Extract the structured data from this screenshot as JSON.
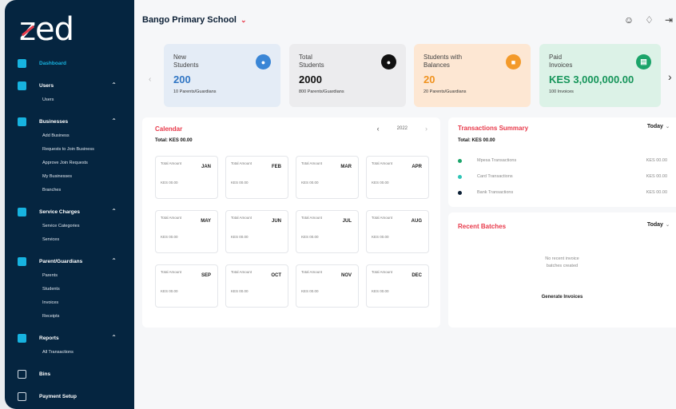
{
  "app": {
    "logo": "zed"
  },
  "sidebar": {
    "items": [
      {
        "label": "Dashboard",
        "active": true,
        "expandable": false,
        "children": []
      },
      {
        "label": "Users",
        "expandable": true,
        "children": [
          "Users"
        ]
      },
      {
        "label": "Businesses",
        "expandable": true,
        "children": [
          "Add Business",
          "Requests to Join Business",
          "Approve Join Requests",
          "My Businesses",
          "Branches"
        ]
      },
      {
        "label": "Service Charges",
        "expandable": true,
        "children": [
          "Service Categories",
          "Services"
        ]
      },
      {
        "label": "Parent/Guardians",
        "expandable": true,
        "children": [
          "Parents",
          "Students",
          "Invoices",
          "Receipts"
        ]
      },
      {
        "label": "Reports",
        "expandable": true,
        "children": [
          "All Transactions"
        ]
      },
      {
        "label": "Bins",
        "expandable": false,
        "children": []
      },
      {
        "label": "Payment Setup",
        "expandable": false,
        "children": []
      }
    ]
  },
  "header": {
    "school_name": "Bango Primary School",
    "icons": [
      "user-icon",
      "bell-icon",
      "logout-icon"
    ]
  },
  "stats": [
    {
      "title_line1": "New",
      "title_line2": "Students",
      "value": "200",
      "sub": "10 Parents/Guardians",
      "icon": "user-icon",
      "color": "#3a86d6"
    },
    {
      "title_line1": "Total",
      "title_line2": "Students",
      "value": "2000",
      "sub": "800 Parents/Guardians",
      "icon": "users-icon",
      "color": "#111111"
    },
    {
      "title_line1": "Students with",
      "title_line2": "Balances",
      "value": "20",
      "sub": "20 Parents/Guardians",
      "icon": "wallet-icon",
      "color": "#f39a2a"
    },
    {
      "title_line1": "Paid",
      "title_line2": "Invoices",
      "value": "KES 3,000,000.00",
      "sub": "100 Invoices",
      "icon": "invoice-icon",
      "color": "#1ba46a"
    }
  ],
  "calendar": {
    "title": "Calendar",
    "total": "Total: KES 00.00",
    "year": "2022",
    "months": [
      {
        "name": "JAN",
        "label": "Total Amount",
        "amount": "KES 00.00"
      },
      {
        "name": "FEB",
        "label": "Total Amount",
        "amount": "KES 00.00"
      },
      {
        "name": "MAR",
        "label": "Total Amount",
        "amount": "KES 00.00"
      },
      {
        "name": "APR",
        "label": "Total Amount",
        "amount": "KES 00.00"
      },
      {
        "name": "MAY",
        "label": "Total Amount",
        "amount": "KES 00.00"
      },
      {
        "name": "JUN",
        "label": "Total Amount",
        "amount": "KES 00.00"
      },
      {
        "name": "JUL",
        "label": "Total Amount",
        "amount": "KES 00.00"
      },
      {
        "name": "AUG",
        "label": "Total Amount",
        "amount": "KES 00.00"
      },
      {
        "name": "SEP",
        "label": "Total Amount",
        "amount": "KES 00.00"
      },
      {
        "name": "OCT",
        "label": "Total Amount",
        "amount": "KES 00.00"
      },
      {
        "name": "NOV",
        "label": "Total Amount",
        "amount": "KES 00.00"
      },
      {
        "name": "DEC",
        "label": "Total Amount",
        "amount": "KES 00.00"
      }
    ]
  },
  "transactions": {
    "title": "Transactions Summary",
    "period": "Today",
    "total": "Total: KES 00.00",
    "rows": [
      {
        "label": "Mpesa Transactions",
        "amount": "KES 00.00",
        "color": "#1ba46a"
      },
      {
        "label": "Card Transactions",
        "amount": "KES 00.00",
        "color": "#2ec4b6"
      },
      {
        "label": "Bank Transactions",
        "amount": "KES 00.00",
        "color": "#0b1f35"
      }
    ]
  },
  "recent_batches": {
    "title": "Recent Batches",
    "period": "Today",
    "empty_line1": "No recent invoice",
    "empty_line2": "batches created",
    "action": "Generate Invoices"
  }
}
